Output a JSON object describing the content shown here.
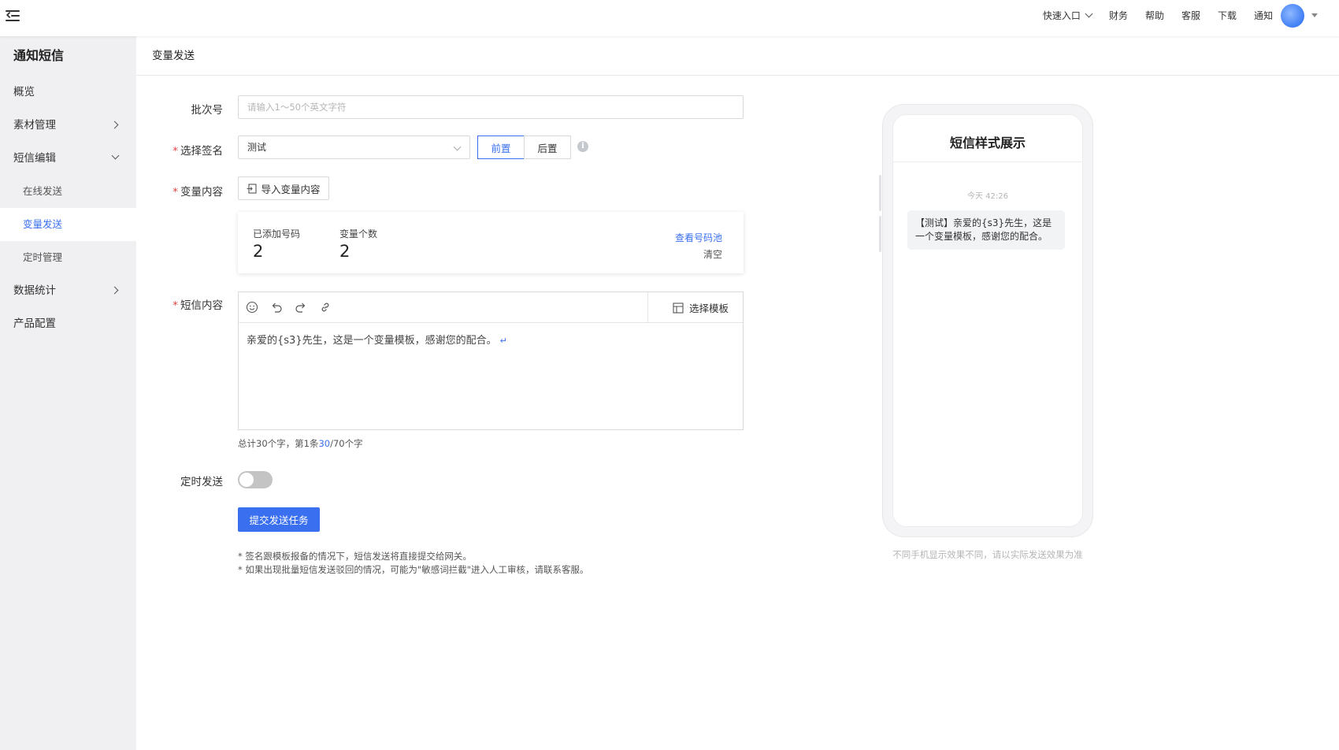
{
  "header": {
    "links": [
      {
        "label": "快速入口",
        "has_dropdown": true
      },
      {
        "label": "财务"
      },
      {
        "label": "帮助"
      },
      {
        "label": "客服"
      },
      {
        "label": "下载"
      },
      {
        "label": "通知"
      }
    ]
  },
  "sidebar": {
    "title": "通知短信",
    "items": [
      {
        "label": "概览"
      },
      {
        "label": "素材管理"
      },
      {
        "label": "短信编辑"
      },
      {
        "label": "在线发送"
      },
      {
        "label": "变量发送"
      },
      {
        "label": "定时管理"
      },
      {
        "label": "数据统计"
      },
      {
        "label": "产品配置"
      }
    ]
  },
  "page": {
    "title": "变量发送"
  },
  "form": {
    "batch_label": "批次号",
    "batch_placeholder": "请输入1～50个英文字符",
    "signature_label": "选择签名",
    "signature_value": "测试",
    "position_before": "前置",
    "position_after": "后置",
    "variable_label": "变量内容",
    "import_button": "导入变量内容",
    "stats": {
      "numbers_label": "已添加号码",
      "numbers_value": "2",
      "variables_label": "变量个数",
      "variables_value": "2",
      "view_pool": "查看号码池",
      "clear": "清空"
    },
    "content_label": "短信内容",
    "template_button": "选择模板",
    "content_text": "亲爱的{s3}先生，这是一个变量模板，感谢您的配合。",
    "counter": {
      "prefix": "总计30个字，第1条",
      "current": "30",
      "suffix": "/70个字"
    },
    "schedule_label": "定时发送",
    "schedule_enabled": false,
    "submit_button": "提交发送任务",
    "notes": [
      "* 签名跟模板报备的情况下，短信发送将直接提交给网关。",
      "* 如果出现批量短信发送驳回的情况，可能为\"敏感词拦截\"进入人工审核，请联系客服。"
    ]
  },
  "preview": {
    "title": "短信样式展示",
    "time": "今天 42:26",
    "message": "【测试】亲爱的{s3}先生，这是一个变量模板，感谢您的配合。",
    "footnote": "不同手机显示效果不同，请以实际发送效果为准"
  },
  "colors": {
    "accent": "#3a6ff0",
    "required": "#e54545",
    "sidebar_bg": "#f0f0f2"
  }
}
